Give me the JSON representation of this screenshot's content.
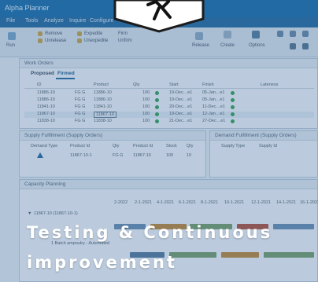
{
  "app": {
    "title": "Alpha Planner",
    "menu": [
      "File",
      "Tools",
      "Analyze",
      "Inquire",
      "Configure"
    ]
  },
  "ribbon": {
    "groups": [
      {
        "label": "Run"
      },
      {
        "label": "Remove"
      },
      {
        "label": "Unrelease"
      },
      {
        "label": "Expedite"
      },
      {
        "label": "Unexpedite"
      },
      {
        "label": "Firm"
      },
      {
        "label": "Unfirm"
      },
      {
        "label": "Release"
      },
      {
        "label": "Create"
      },
      {
        "label": "Options"
      }
    ]
  },
  "work_orders": {
    "header": "Work Orders",
    "tabs": [
      "Proposed",
      "Firmed"
    ],
    "active_tab": "Firmed",
    "columns": [
      "ID",
      "Product",
      "Qty",
      "Start",
      "Finish",
      "Lateness"
    ],
    "rows": [
      {
        "id": "11886-10",
        "site": "FG G",
        "product": "11886-10",
        "qty": "100",
        "start": "19-Dec…e1",
        "finish": "05-Jan…e1"
      },
      {
        "id": "11886-10",
        "site": "FG G",
        "product": "11886-10",
        "qty": "100",
        "start": "19-Dec…e1",
        "finish": "05-Jan…e1"
      },
      {
        "id": "11841-10",
        "site": "FG G",
        "product": "11841-10",
        "qty": "100",
        "start": "20-Dec…e1",
        "finish": "11-Dec…e1"
      },
      {
        "id": "11867-10",
        "site": "FG G",
        "product": "11867-10",
        "qty": "100",
        "start": "19-Dec…e1",
        "finish": "12-Jan…e1"
      },
      {
        "id": "11838-10",
        "site": "FG G",
        "product": "11838-10",
        "qty": "100",
        "start": "21-Dec…e1",
        "finish": "27-Dec…e1"
      }
    ]
  },
  "supply_panel": {
    "header": "Supply Fulfillment (Supply Orders)",
    "columns": [
      "Demand Type",
      "Product Id",
      "Qty",
      "Product Id",
      "Stock",
      "Qty"
    ],
    "row": {
      "product": "11867-10-1",
      "site": "FG G",
      "product2": "11867-10",
      "qty": "100",
      "qty2": "10"
    }
  },
  "demand_panel": {
    "header": "Demand Fulfillment (Supply Orders)",
    "columns": [
      "Supply Type",
      "Supply Id"
    ]
  },
  "capacity": {
    "header": "Capacity Planning",
    "dates": [
      "2-2022",
      "2-1-2021",
      "4-1-2021",
      "6-1-2021",
      "8-1-2021",
      "10-1-2021",
      "12-1-2021",
      "14-1-2021",
      "16-1-2021"
    ],
    "row_label": "11867-10 (11867-10-1)",
    "sub_label": "1 Batch ampoulry - Automated"
  },
  "overlay": {
    "caption_line1": "Testing & Continuous",
    "caption_line2": "improvement",
    "badge_icon": "running-person-icon"
  },
  "colors": {
    "titlebar": "#1f6fa8",
    "overlay": "#2a6da0",
    "caption": "#ffffff",
    "status_ok": "#3aa35a"
  }
}
